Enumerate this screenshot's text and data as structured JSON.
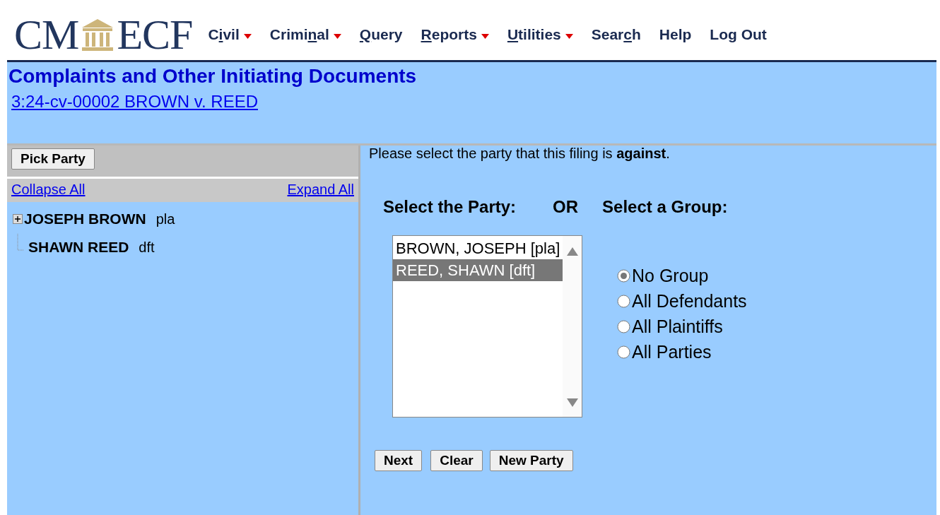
{
  "logo": {
    "left": "CM",
    "right": "ECF"
  },
  "menu": [
    {
      "label": {
        "pre": "C",
        "key": "i",
        "post": "vil"
      },
      "dropdown": true
    },
    {
      "label": {
        "pre": "Crimi",
        "key": "n",
        "post": "al"
      },
      "dropdown": true
    },
    {
      "label": {
        "key": "Q",
        "post": "uery"
      },
      "dropdown": false
    },
    {
      "label": {
        "key": "R",
        "post": "eports"
      },
      "dropdown": true
    },
    {
      "label": {
        "key": "U",
        "post": "tilities"
      },
      "dropdown": true
    },
    {
      "label": {
        "pre": "Sear",
        "key": "c",
        "post": "h"
      },
      "dropdown": false
    },
    {
      "label": {
        "pre": "Help"
      },
      "dropdown": false
    },
    {
      "label": {
        "pre": "Log Out"
      },
      "dropdown": false
    }
  ],
  "page_title": "Complaints and Other Initiating Documents",
  "case_link": "3:24-cv-00002 BROWN v. REED",
  "sidebar": {
    "button": "Pick Party",
    "collapse": "Collapse All",
    "expand": "Expand All",
    "tree": [
      {
        "name": "JOSEPH BROWN",
        "role": "pla",
        "expandable": true
      },
      {
        "name": "SHAWN REED",
        "role": "dft",
        "expandable": false
      }
    ]
  },
  "instruction": "Please select the party that this filing is **against**.",
  "party_heading": "Select the Party:",
  "or_label": "OR",
  "group_heading": "Select a Group:",
  "parties": [
    {
      "label": "BROWN, JOSEPH [pla]",
      "selected": false
    },
    {
      "label": "REED, SHAWN [dft]",
      "selected": true
    }
  ],
  "groups": [
    {
      "label": "No Group",
      "selected": true
    },
    {
      "label": "All Defendants",
      "selected": false
    },
    {
      "label": "All Plaintiffs",
      "selected": false
    },
    {
      "label": "All Parties",
      "selected": false
    }
  ],
  "buttons": [
    "Next",
    "Clear",
    "New Party"
  ]
}
